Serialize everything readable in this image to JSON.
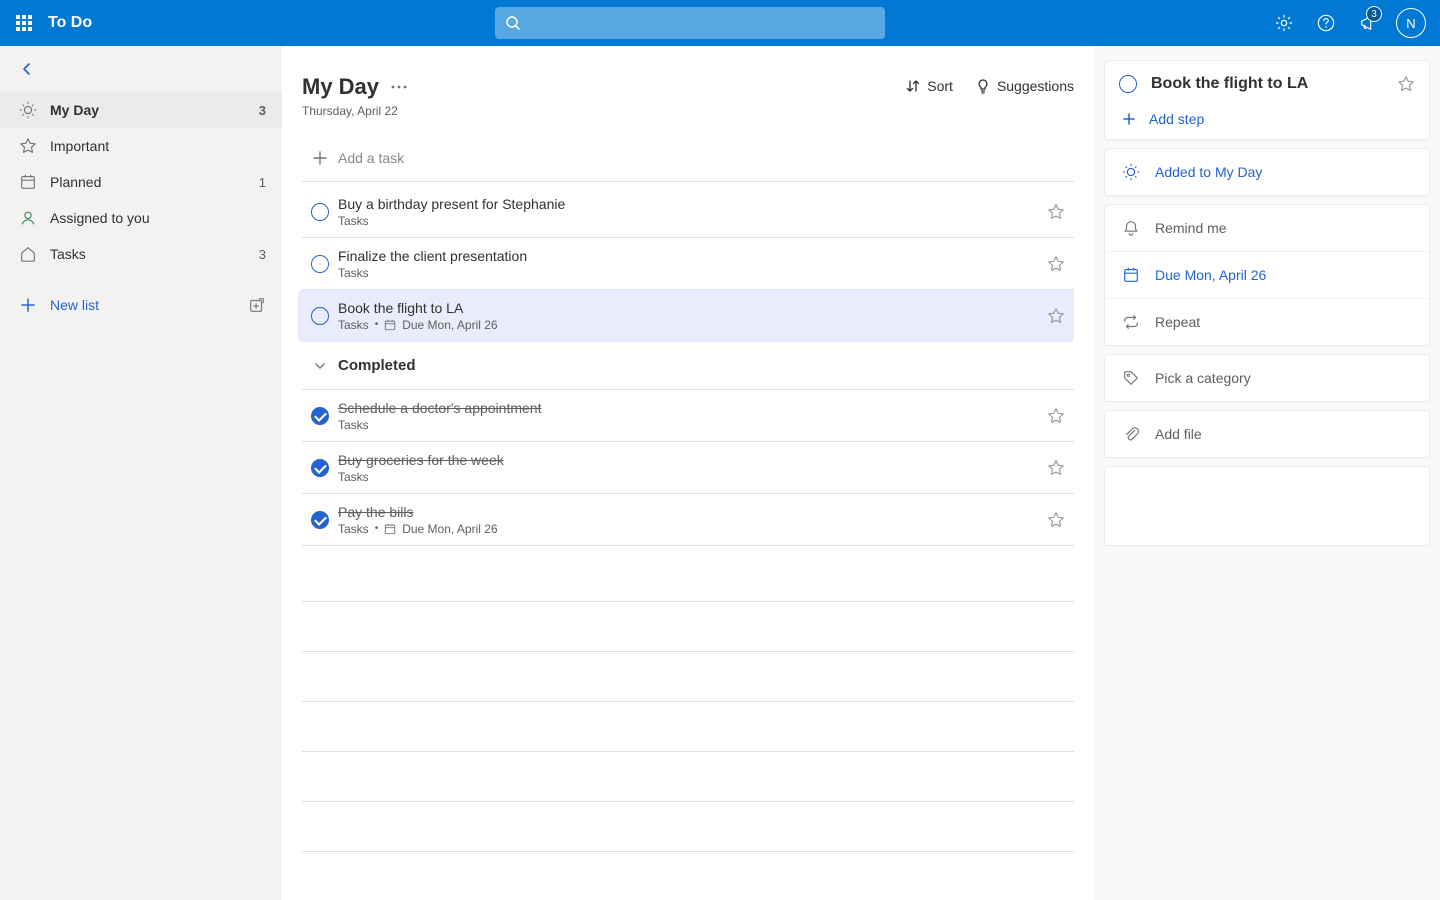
{
  "header": {
    "app_title": "To Do",
    "notification_count": "3",
    "avatar_initial": "N"
  },
  "sidebar": {
    "items": [
      {
        "icon": "sun",
        "label": "My Day",
        "count": "3",
        "active": true
      },
      {
        "icon": "star",
        "label": "Important",
        "count": "",
        "active": false
      },
      {
        "icon": "calendar",
        "label": "Planned",
        "count": "1",
        "active": false
      },
      {
        "icon": "person",
        "label": "Assigned to you",
        "count": "",
        "active": false
      },
      {
        "icon": "home",
        "label": "Tasks",
        "count": "3",
        "active": false
      }
    ],
    "new_list_label": "New list"
  },
  "main": {
    "title": "My Day",
    "date": "Thursday, April 22",
    "sort_label": "Sort",
    "suggestions_label": "Suggestions",
    "add_placeholder": "Add a task",
    "completed_header": "Completed",
    "tasks": [
      {
        "title": "Buy a birthday present for Stephanie",
        "list": "Tasks",
        "due": "",
        "selected": false
      },
      {
        "title": "Finalize the client presentation",
        "list": "Tasks",
        "due": "",
        "selected": false
      },
      {
        "title": "Book the flight to LA",
        "list": "Tasks",
        "due": "Due Mon, April 26",
        "selected": true
      }
    ],
    "completed": [
      {
        "title": "Schedule a doctor's appointment",
        "list": "Tasks",
        "due": ""
      },
      {
        "title": "Buy groceries for the week",
        "list": "Tasks",
        "due": ""
      },
      {
        "title": "Pay the bills",
        "list": "Tasks",
        "due": "Due Mon, April 26"
      }
    ]
  },
  "detail": {
    "title": "Book the flight to LA",
    "add_step": "Add step",
    "my_day_label": "Added to My Day",
    "remind_label": "Remind me",
    "due_label": "Due Mon, April 26",
    "repeat_label": "Repeat",
    "category_label": "Pick a category",
    "file_label": "Add file"
  }
}
